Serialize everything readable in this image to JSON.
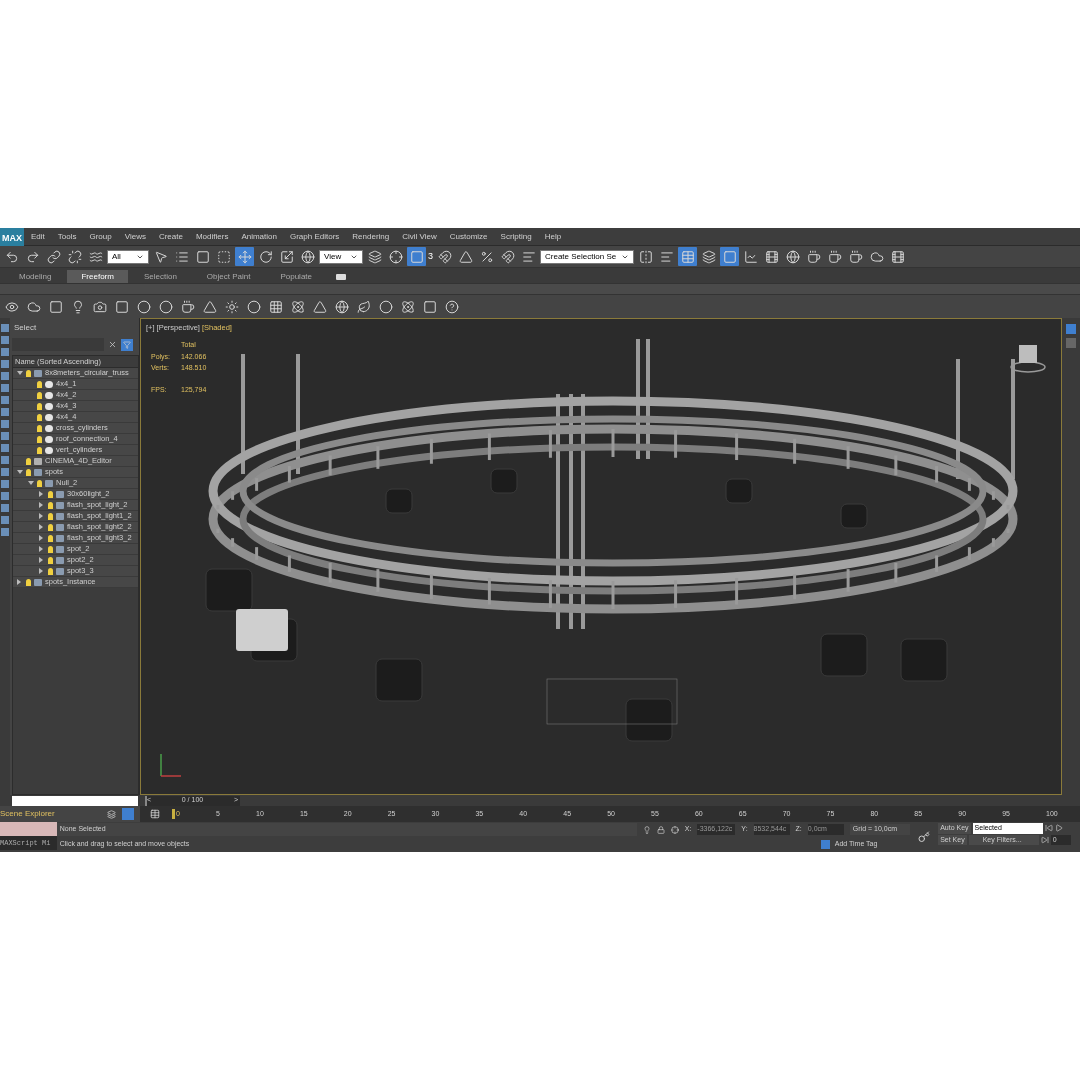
{
  "app": {
    "logo": "MAX"
  },
  "menu": [
    "Edit",
    "Tools",
    "Group",
    "Views",
    "Create",
    "Modifiers",
    "Animation",
    "Graph Editors",
    "Rendering",
    "Civil View",
    "Customize",
    "Scripting",
    "Help"
  ],
  "toolbar": {
    "filter": "All",
    "coord_system": "View",
    "selection_set": "Create Selection Se",
    "snap_angle": "3"
  },
  "ribbon_tabs": [
    {
      "label": "Modeling",
      "selected": false
    },
    {
      "label": "Freeform",
      "selected": true
    },
    {
      "label": "Selection",
      "selected": false
    },
    {
      "label": "Object Paint",
      "selected": false
    },
    {
      "label": "Populate",
      "selected": false
    }
  ],
  "explorer": {
    "title": "Select",
    "column": "Name (Sorted Ascending)",
    "footer": "Scene Explorer",
    "tree": [
      {
        "name": "8x8meters_circular_truss",
        "kind": "group",
        "expanded": true,
        "children": [
          {
            "name": "4x4_1",
            "kind": "geometry"
          },
          {
            "name": "4x4_2",
            "kind": "geometry"
          },
          {
            "name": "4x4_3",
            "kind": "geometry"
          },
          {
            "name": "4x4_4",
            "kind": "geometry"
          },
          {
            "name": "cross_cylinders",
            "kind": "geometry"
          },
          {
            "name": "roof_connection_4",
            "kind": "geometry"
          },
          {
            "name": "vert_cylinders",
            "kind": "geometry"
          }
        ]
      },
      {
        "name": "CINEMA_4D_Editor",
        "kind": "camera"
      },
      {
        "name": "spots",
        "kind": "group",
        "expanded": true,
        "children": [
          {
            "name": "Null_2",
            "kind": "group",
            "expanded": true,
            "children": [
              {
                "name": "30x60light_2",
                "kind": "group",
                "expanded": false
              },
              {
                "name": "flash_spot_light_2",
                "kind": "group",
                "expanded": false
              },
              {
                "name": "flash_spot_light1_2",
                "kind": "group",
                "expanded": false
              },
              {
                "name": "flash_spot_light2_2",
                "kind": "group",
                "expanded": false
              },
              {
                "name": "flash_spot_light3_2",
                "kind": "group",
                "expanded": false
              },
              {
                "name": "spot_2",
                "kind": "group",
                "expanded": false
              },
              {
                "name": "spot2_2",
                "kind": "group",
                "expanded": false
              },
              {
                "name": "spot3_3",
                "kind": "group",
                "expanded": false
              }
            ]
          }
        ]
      },
      {
        "name": "spots_Instance",
        "kind": "group",
        "expanded": false
      }
    ]
  },
  "viewport": {
    "labels": [
      "[+]",
      "[Perspective]",
      "[Shaded]"
    ],
    "stats_header": "Total",
    "stats": [
      {
        "label": "Polys:",
        "value": "142.066"
      },
      {
        "label": "Verts:",
        "value": "148.510"
      },
      {
        "label": "FPS:",
        "value": "125,794"
      }
    ]
  },
  "timeline": {
    "frame": "0 / 100",
    "prev": "<",
    "next": ">",
    "ticks": [
      "0",
      "5",
      "10",
      "15",
      "20",
      "25",
      "30",
      "35",
      "40",
      "45",
      "50",
      "55",
      "60",
      "65",
      "70",
      "75",
      "80",
      "85",
      "90",
      "95",
      "100"
    ],
    "level": 0
  },
  "status": {
    "maxscript": "MAXScript Mi",
    "selection": "None Selected",
    "prompt": "Click and drag to select and move objects",
    "x_label": "X:",
    "x": "-3366,122c",
    "y_label": "Y:",
    "y": "8532,544c",
    "z_label": "Z:",
    "z": "0,0cm",
    "grid": "Grid = 10,0cm",
    "time_tag": "Add Time Tag",
    "auto_key": "Auto Key",
    "set_key": "Set Key",
    "key_mode": "Selected",
    "key_filters": "Key Filters...",
    "current_frame": "0"
  }
}
